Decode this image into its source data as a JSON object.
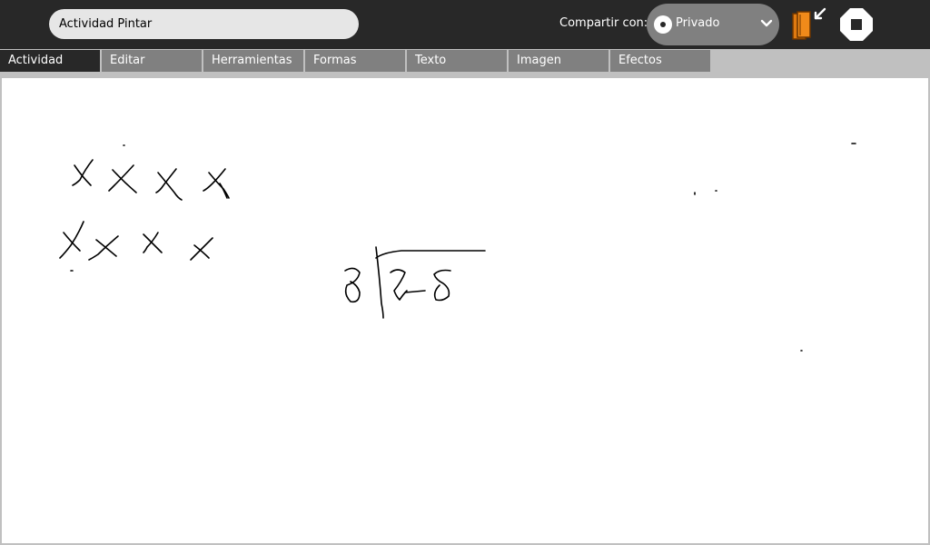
{
  "toolbar": {
    "activity_title": "Actividad Pintar",
    "share_label": "Compartir con:",
    "share_value": "Privado",
    "journal_icon": "journal-icon",
    "stop_icon": "stop-icon"
  },
  "tabs": [
    {
      "label": "Actividad",
      "active": true
    },
    {
      "label": "Editar",
      "active": false
    },
    {
      "label": "Herramientas",
      "active": false
    },
    {
      "label": "Formas",
      "active": false
    },
    {
      "label": "Texto",
      "active": false
    },
    {
      "label": "Imagen",
      "active": false
    },
    {
      "label": "Efectos",
      "active": false
    }
  ],
  "colors": {
    "toolbar_bg": "#282828",
    "tab_bg": "#808080",
    "tab_active_bg": "#282828",
    "canvas_bg": "#ffffff",
    "journal_orange": "#e07a10"
  }
}
